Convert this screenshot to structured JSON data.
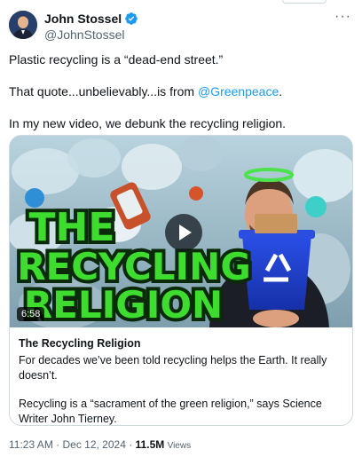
{
  "author": {
    "name": "John Stossel",
    "handle": "@JohnStossel",
    "verified": true,
    "avatar_icon": "profile-photo"
  },
  "more_icon": "more-options-icon",
  "tweet": {
    "line1": "Plastic recycling is a “dead-end street.”",
    "line2_prefix": "That quote...unbelievably...is from ",
    "line2_mention": "@Greenpeace",
    "line2_suffix": ".",
    "line3": "In my new video, we debunk the recycling religion."
  },
  "card": {
    "thumbnail_text_line1": "THE",
    "thumbnail_text_line2": "RECYCLING",
    "thumbnail_text_line3": "RELIGION",
    "duration": "6:58",
    "title": "The Recycling Religion",
    "description": "For decades we’ve been told recycling helps the Earth. It really doesn’t.",
    "description2": "Recycling is a “sacrament of the green religion,” says Science Writer John Tierney."
  },
  "meta": {
    "time": "11:23 AM",
    "separator": " · ",
    "date": "Dec 12, 2024",
    "views_count": "11.5M",
    "views_label": "Views"
  },
  "colors": {
    "link": "#1d9bf0",
    "verified": "#1d9bf0",
    "title_green": "#3ddc2f",
    "bin_blue": "#1f3fd1"
  }
}
